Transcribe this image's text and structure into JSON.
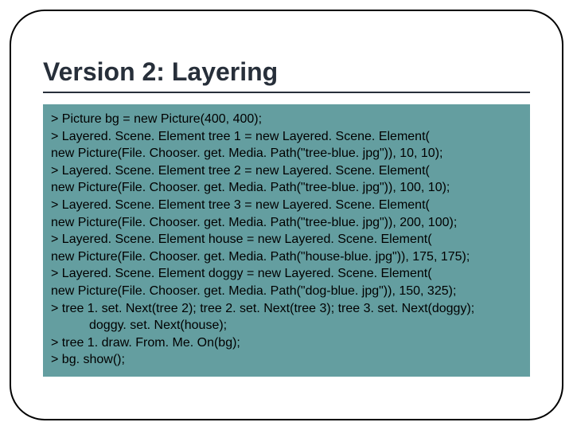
{
  "title": "Version 2: Layering",
  "code": {
    "l1": "> Picture bg = new Picture(400, 400);",
    "l2": "> Layered. Scene. Element tree 1 = new Layered. Scene. Element(",
    "l3": "new Picture(File. Chooser. get. Media. Path(\"tree-blue. jpg\")), 10, 10);",
    "l4": "> Layered. Scene. Element tree 2 = new Layered. Scene. Element(",
    "l5": "new Picture(File. Chooser. get. Media. Path(\"tree-blue. jpg\")), 100, 10);",
    "l6": "> Layered. Scene. Element tree 3 = new Layered. Scene. Element(",
    "l7": "new Picture(File. Chooser. get. Media. Path(\"tree-blue. jpg\")), 200, 100);",
    "l8": "> Layered. Scene. Element house = new Layered. Scene. Element(",
    "l9": "new Picture(File. Chooser. get. Media. Path(\"house-blue. jpg\")), 175, 175);",
    "l10": "> Layered. Scene. Element doggy = new Layered. Scene. Element(",
    "l11": "new Picture(File. Chooser. get. Media. Path(\"dog-blue. jpg\")), 150, 325);",
    "l12": "> tree 1. set. Next(tree 2); tree 2. set. Next(tree 3); tree 3. set. Next(doggy);",
    "l13": "doggy. set. Next(house);",
    "l14": "> tree 1. draw. From. Me. On(bg);",
    "l15": "> bg. show();"
  }
}
